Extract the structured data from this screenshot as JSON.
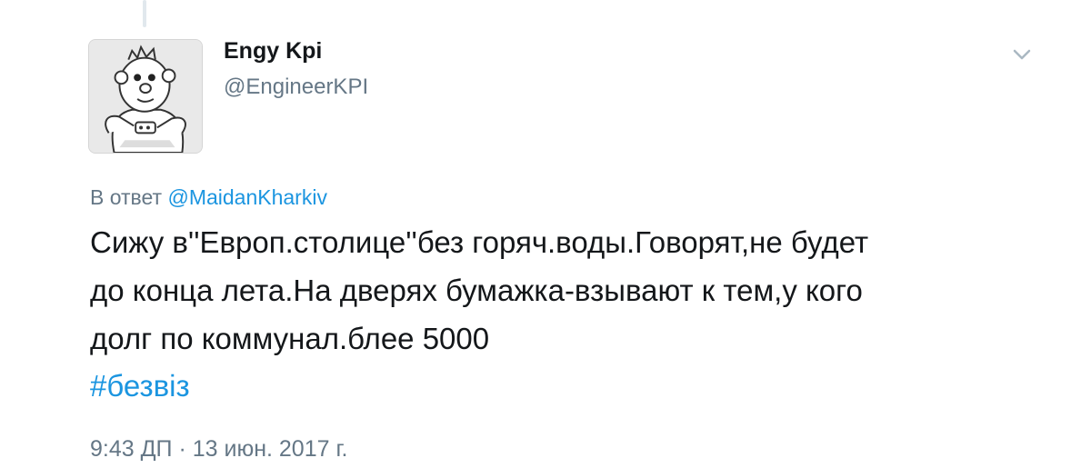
{
  "author": {
    "display_name": "Engy Kpi",
    "handle": "@EngineerKPI",
    "avatar": "cartoon-character-avatar"
  },
  "menu": {
    "icon": "chevron-down-icon"
  },
  "reply": {
    "prefix": "В ответ",
    "mention": "@MaidanKharkiv"
  },
  "tweet": {
    "lines": [
      "Сижу в''Европ.столице''без горяч.воды.Говорят,не будет",
      "до конца лета.На дверях бумажка-взывают к тем,у кого",
      "долг по коммунал.блее 5000"
    ],
    "hashtag": "#безвіз"
  },
  "timestamp": "9:43 ДП · 13 июн. 2017 г.",
  "colors": {
    "link": "#1b95e0",
    "secondary_text": "#657786",
    "primary_text": "#14171a"
  }
}
